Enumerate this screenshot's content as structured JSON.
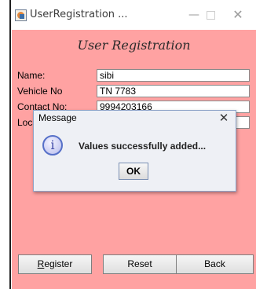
{
  "window": {
    "title": "UserRegistration ...",
    "min_glyph": "—",
    "close_glyph": "✕"
  },
  "form": {
    "title": "User Registration",
    "fields": [
      {
        "label": "Name:",
        "value": "sibi"
      },
      {
        "label": "Vehicle No",
        "value": "TN 7783"
      },
      {
        "label": "Contact No:",
        "value": "9994203166"
      },
      {
        "label": "Location:",
        "value": ""
      }
    ]
  },
  "dialog": {
    "title": "Message",
    "close_glyph": "✕",
    "icon_glyph": "i",
    "message": "Values successfully added...",
    "ok_label": "OK"
  },
  "buttons": {
    "register_mnemonic": "R",
    "register_rest": "egister",
    "reset": "Reset",
    "back": "Back"
  },
  "colors": {
    "window_bg": "#ffa2a2",
    "dialog_bg": "#eef0f5",
    "dialog_border": "#8ea3c8"
  }
}
